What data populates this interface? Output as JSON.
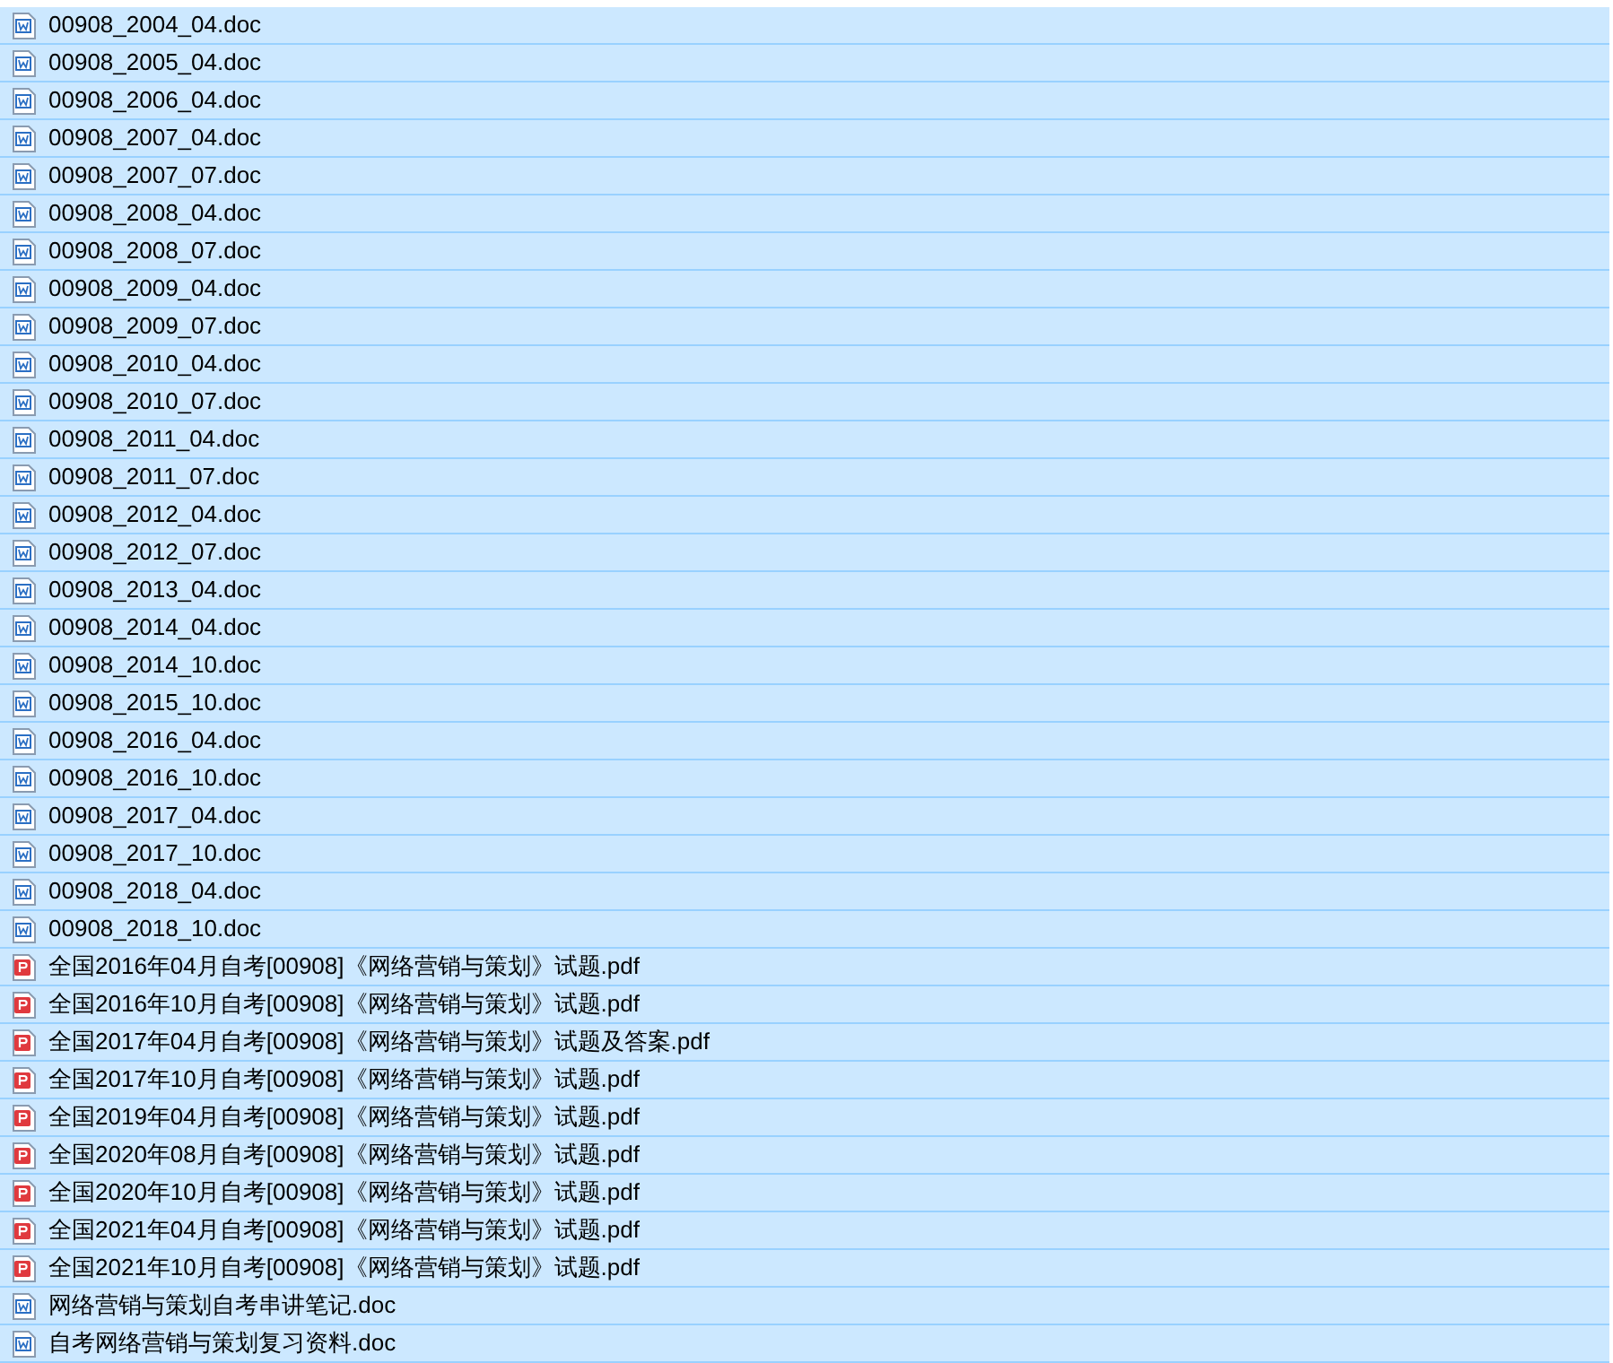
{
  "files": [
    {
      "name": "00908_2004_04.doc",
      "kind": "doc",
      "selected": true
    },
    {
      "name": "00908_2005_04.doc",
      "kind": "doc",
      "selected": true
    },
    {
      "name": "00908_2006_04.doc",
      "kind": "doc",
      "selected": true
    },
    {
      "name": "00908_2007_04.doc",
      "kind": "doc",
      "selected": true
    },
    {
      "name": "00908_2007_07.doc",
      "kind": "doc",
      "selected": true
    },
    {
      "name": "00908_2008_04.doc",
      "kind": "doc",
      "selected": true
    },
    {
      "name": "00908_2008_07.doc",
      "kind": "doc",
      "selected": true
    },
    {
      "name": "00908_2009_04.doc",
      "kind": "doc",
      "selected": true
    },
    {
      "name": "00908_2009_07.doc",
      "kind": "doc",
      "selected": true
    },
    {
      "name": "00908_2010_04.doc",
      "kind": "doc",
      "selected": true
    },
    {
      "name": "00908_2010_07.doc",
      "kind": "doc",
      "selected": true
    },
    {
      "name": "00908_2011_04.doc",
      "kind": "doc",
      "selected": true
    },
    {
      "name": "00908_2011_07.doc",
      "kind": "doc",
      "selected": true
    },
    {
      "name": "00908_2012_04.doc",
      "kind": "doc",
      "selected": true
    },
    {
      "name": "00908_2012_07.doc",
      "kind": "doc",
      "selected": true
    },
    {
      "name": "00908_2013_04.doc",
      "kind": "doc",
      "selected": true
    },
    {
      "name": "00908_2014_04.doc",
      "kind": "doc",
      "selected": true
    },
    {
      "name": "00908_2014_10.doc",
      "kind": "doc",
      "selected": true
    },
    {
      "name": "00908_2015_10.doc",
      "kind": "doc",
      "selected": true
    },
    {
      "name": "00908_2016_04.doc",
      "kind": "doc",
      "selected": true
    },
    {
      "name": "00908_2016_10.doc",
      "kind": "doc",
      "selected": true
    },
    {
      "name": "00908_2017_04.doc",
      "kind": "doc",
      "selected": true
    },
    {
      "name": "00908_2017_10.doc",
      "kind": "doc",
      "selected": true
    },
    {
      "name": "00908_2018_04.doc",
      "kind": "doc",
      "selected": true
    },
    {
      "name": "00908_2018_10.doc",
      "kind": "doc",
      "selected": true
    },
    {
      "name": "全国2016年04月自考[00908]《网络营销与策划》试题.pdf",
      "kind": "pdf",
      "selected": true
    },
    {
      "name": "全国2016年10月自考[00908]《网络营销与策划》试题.pdf",
      "kind": "pdf",
      "selected": true
    },
    {
      "name": "全国2017年04月自考[00908]《网络营销与策划》试题及答案.pdf",
      "kind": "pdf",
      "selected": true
    },
    {
      "name": "全国2017年10月自考[00908]《网络营销与策划》试题.pdf",
      "kind": "pdf",
      "selected": true
    },
    {
      "name": "全国2019年04月自考[00908]《网络营销与策划》试题.pdf",
      "kind": "pdf",
      "selected": true
    },
    {
      "name": "全国2020年08月自考[00908]《网络营销与策划》试题.pdf",
      "kind": "pdf",
      "selected": true
    },
    {
      "name": "全国2020年10月自考[00908]《网络营销与策划》试题.pdf",
      "kind": "pdf",
      "selected": true
    },
    {
      "name": "全国2021年04月自考[00908]《网络营销与策划》试题.pdf",
      "kind": "pdf",
      "selected": true
    },
    {
      "name": "全国2021年10月自考[00908]《网络营销与策划》试题.pdf",
      "kind": "pdf",
      "selected": true
    },
    {
      "name": "网络营销与策划自考串讲笔记.doc",
      "kind": "doc",
      "selected": true
    },
    {
      "name": "自考网络营销与策划复习资料.doc",
      "kind": "doc",
      "selected": true
    }
  ]
}
